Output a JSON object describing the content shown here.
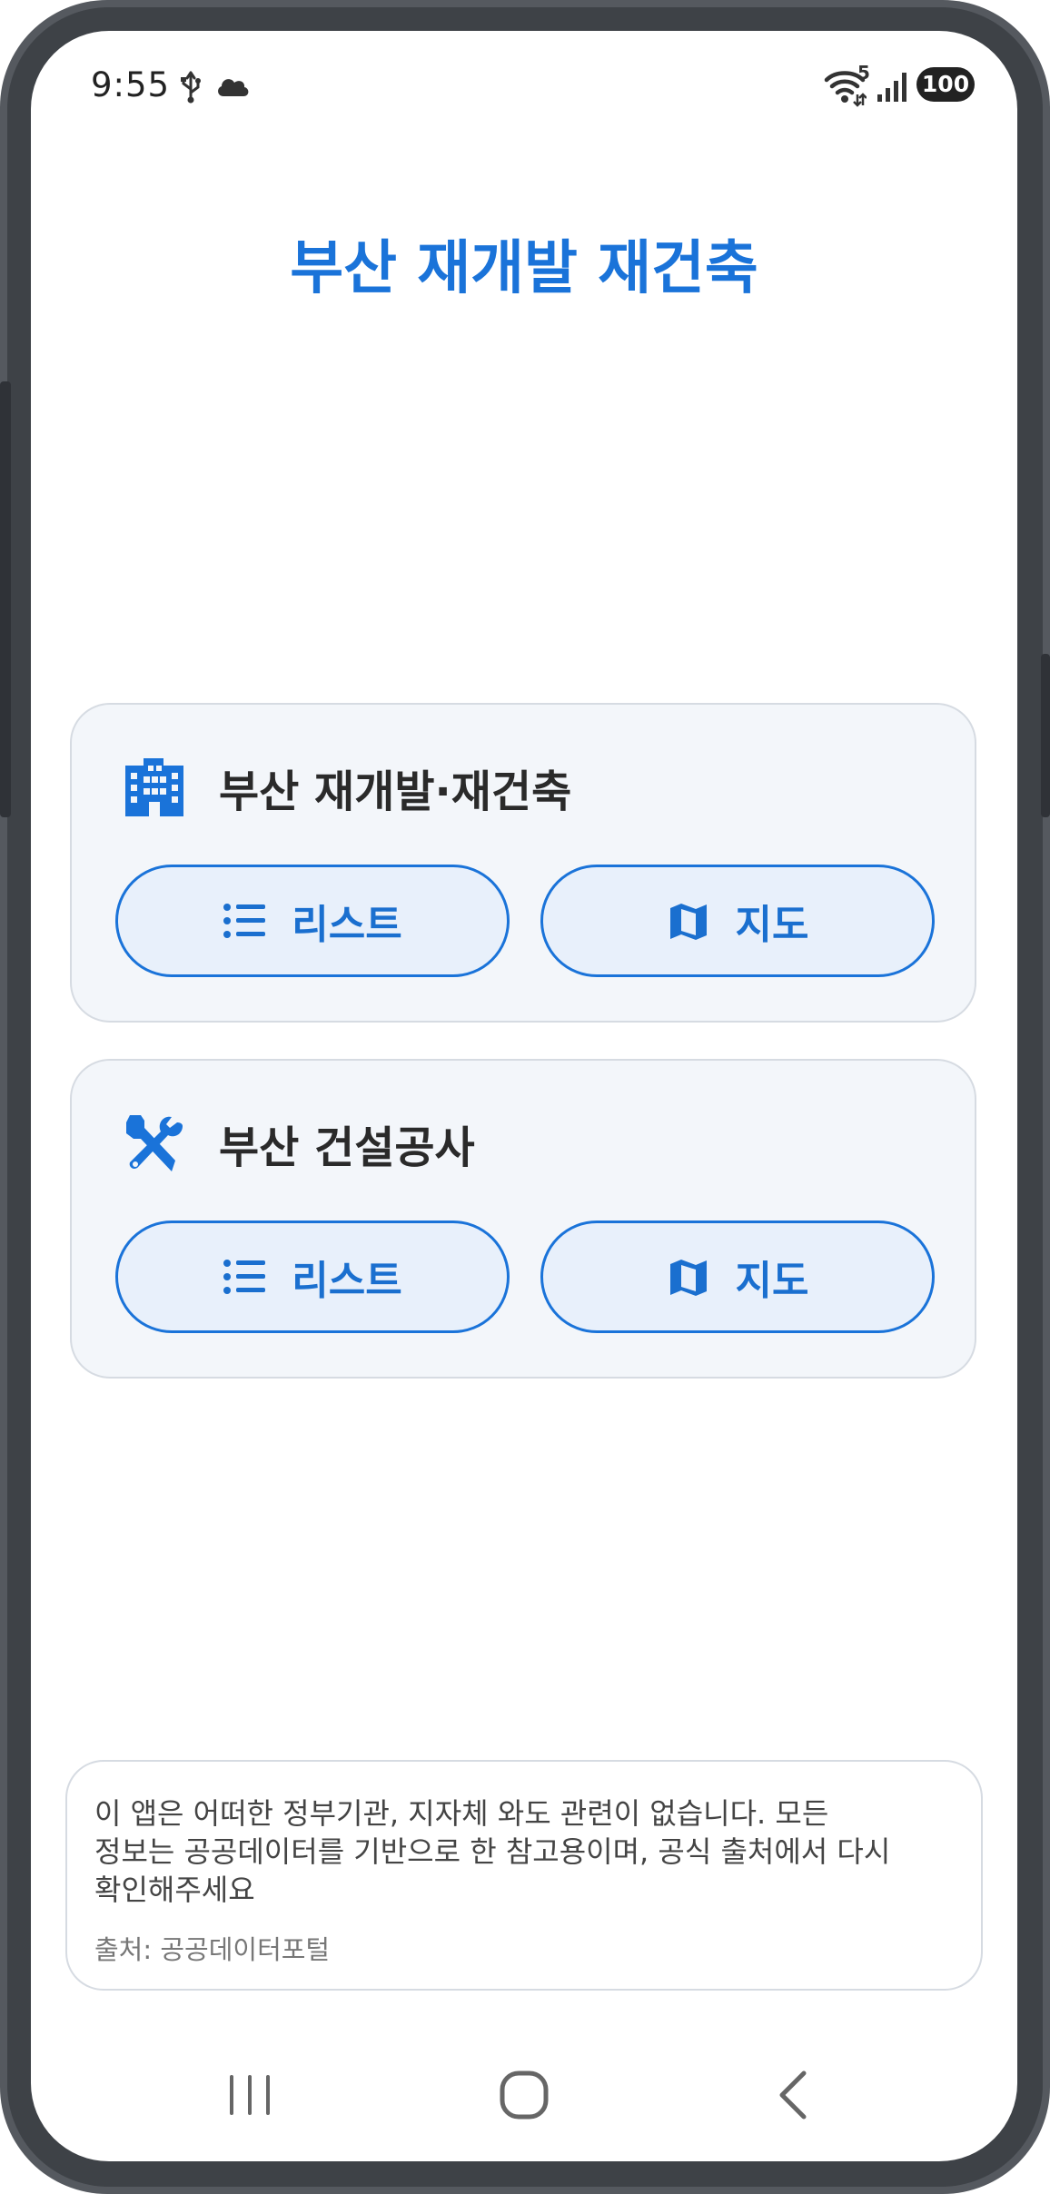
{
  "status_bar": {
    "time": "9:55",
    "icons": [
      "usb-icon",
      "cloud-icon",
      "wifi-icon",
      "signal-icon"
    ],
    "wifi_badge": "5",
    "battery": "100"
  },
  "app": {
    "title": "부산 재개발 재건축",
    "accent_color": "#1a73d9"
  },
  "cards": [
    {
      "icon": "building-icon",
      "title": "부산 재개발·재건축",
      "list_label": "리스트",
      "map_label": "지도"
    },
    {
      "icon": "tools-icon",
      "title": "부산 건설공사",
      "list_label": "리스트",
      "map_label": "지도"
    }
  ],
  "disclaimer": {
    "line1": "이 앱은 어떠한 정부기관, 지자체 와도 관련이 없습니다. 모든",
    "line2": "정보는 공공데이터를 기반으로 한 참고용이며, 공식 출처에서 다시",
    "line3": "확인해주세요",
    "source": "출처: 공공데이터포털"
  },
  "nav": {
    "icons": [
      "recents-icon",
      "home-icon",
      "back-icon"
    ]
  }
}
